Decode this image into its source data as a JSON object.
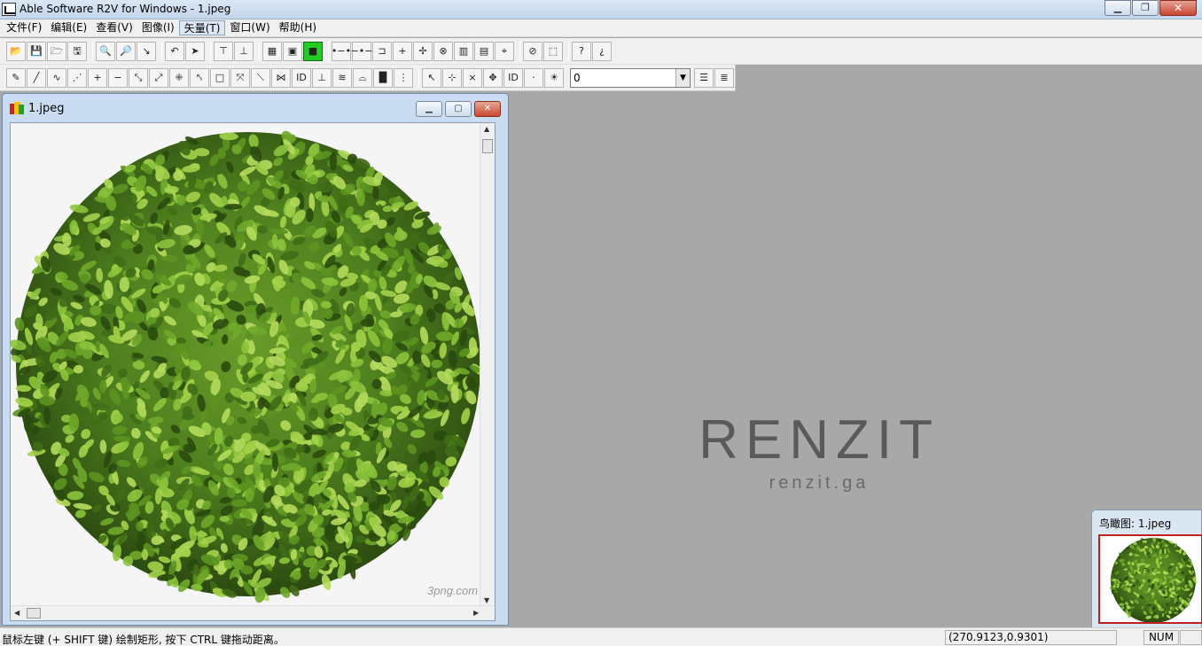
{
  "app": {
    "title": "Able Software R2V for Windows - 1.jpeg",
    "icon": "r2v-app-icon"
  },
  "window_buttons": {
    "minimize": "▁",
    "maximize": "❐",
    "close": "✕"
  },
  "menu": [
    {
      "label": "文件(F)"
    },
    {
      "label": "编辑(E)"
    },
    {
      "label": "查看(V)"
    },
    {
      "label": "图像(I)"
    },
    {
      "label": "矢量(T)",
      "active": true
    },
    {
      "label": "窗口(W)"
    },
    {
      "label": "帮助(H)"
    }
  ],
  "toolbar1": {
    "groups": [
      [
        {
          "icon": "open-icon",
          "glyph": "📂"
        },
        {
          "icon": "save-icon",
          "glyph": "💾"
        },
        {
          "icon": "open-image-icon",
          "glyph": "🗁"
        },
        {
          "icon": "save-as-icon",
          "glyph": "🖫"
        }
      ],
      [
        {
          "icon": "zoom-in-icon",
          "glyph": "🔍"
        },
        {
          "icon": "zoom-out-icon",
          "glyph": "🔎"
        },
        {
          "icon": "line-tool-icon",
          "glyph": "↘"
        }
      ],
      [
        {
          "icon": "undo-icon",
          "glyph": "↶"
        },
        {
          "icon": "select-arrow-icon",
          "glyph": "➤"
        }
      ],
      [
        {
          "icon": "trace-icon",
          "glyph": "⊤"
        },
        {
          "icon": "trace-all-icon",
          "glyph": "⊥"
        }
      ],
      [
        {
          "icon": "color-image-icon",
          "glyph": "▦"
        },
        {
          "icon": "frame-icon",
          "glyph": "▣"
        },
        {
          "icon": "green-fill-icon",
          "glyph": "■",
          "green": true
        }
      ],
      [
        {
          "icon": "node-icon",
          "glyph": "•−•"
        },
        {
          "icon": "node-line-icon",
          "glyph": "−•−"
        },
        {
          "icon": "node-label-icon",
          "glyph": "⊐"
        },
        {
          "icon": "vertex-icon",
          "glyph": "+"
        },
        {
          "icon": "vertex-move-icon",
          "glyph": "✢"
        },
        {
          "icon": "circle-x-icon",
          "glyph": "⊗"
        },
        {
          "icon": "ocr-icon",
          "glyph": "▥"
        },
        {
          "icon": "ocr-all-icon",
          "glyph": "▤"
        },
        {
          "icon": "crosshair-icon",
          "glyph": "⌖"
        }
      ],
      [
        {
          "icon": "delete-select-icon",
          "glyph": "⊘"
        },
        {
          "icon": "select-box-icon",
          "glyph": "⬚"
        }
      ],
      [
        {
          "icon": "help-icon",
          "glyph": "?"
        },
        {
          "icon": "context-help-icon",
          "glyph": "¿"
        }
      ]
    ]
  },
  "toolbar2": {
    "groups": [
      [
        {
          "icon": "edit-node-icon",
          "glyph": "✎"
        },
        {
          "icon": "draw-line-icon",
          "glyph": "╱"
        },
        {
          "icon": "curve-icon",
          "glyph": "∿"
        },
        {
          "icon": "dash-line-icon",
          "glyph": "⋰"
        },
        {
          "icon": "add-vertex-icon",
          "glyph": "+"
        },
        {
          "icon": "remove-vertex-icon",
          "glyph": "−"
        },
        {
          "icon": "join-icon",
          "glyph": "⤡"
        },
        {
          "icon": "split-icon",
          "glyph": "⤢"
        },
        {
          "icon": "snap-icon",
          "glyph": "⁜"
        },
        {
          "icon": "smooth-icon",
          "glyph": "⤣"
        },
        {
          "icon": "rectangle-icon",
          "glyph": "□"
        },
        {
          "icon": "rotate-icon",
          "glyph": "⤧"
        },
        {
          "icon": "diagonal-icon",
          "glyph": "⟍"
        },
        {
          "icon": "merge-icon",
          "glyph": "⋈"
        },
        {
          "icon": "id-icon",
          "glyph": "ID"
        },
        {
          "icon": "label-icon",
          "glyph": "⊥"
        },
        {
          "icon": "contour-icon",
          "glyph": "≋"
        },
        {
          "icon": "slope-icon",
          "glyph": "⌓"
        },
        {
          "icon": "fill-icon",
          "glyph": "█"
        },
        {
          "icon": "bracket-icon",
          "glyph": "⋮"
        }
      ],
      [
        {
          "icon": "pointer-icon",
          "glyph": "↖"
        },
        {
          "icon": "point-add-icon",
          "glyph": "⊹"
        },
        {
          "icon": "point-delete-icon",
          "glyph": "×"
        },
        {
          "icon": "point-move-icon",
          "glyph": "✥"
        },
        {
          "icon": "point-id-icon",
          "glyph": "ID"
        },
        {
          "icon": "point-label-icon",
          "glyph": "·"
        },
        {
          "icon": "light-icon",
          "glyph": "☀"
        }
      ]
    ],
    "combo_value": "0",
    "trailing": [
      {
        "icon": "layer-stack-icon",
        "glyph": "☰"
      },
      {
        "icon": "layer-props-icon",
        "glyph": "≣"
      }
    ]
  },
  "document": {
    "title": "1.jpeg",
    "watermark": "3png.com"
  },
  "background_brand": {
    "main": "RENZIT",
    "sub": "renzit.ga"
  },
  "birdseye": {
    "title": "鸟瞰图: 1.jpeg"
  },
  "statusbar": {
    "message": "鼠标左键 (+ SHIFT 键) 绘制矩形, 按下 CTRL 键拖动距离。",
    "coords": "(270.9123,0.9301)",
    "num": "NUM"
  },
  "colors": {
    "workspace": "#a8a8a8",
    "foliage": "#4e7f1e",
    "selection": "#c02020"
  }
}
